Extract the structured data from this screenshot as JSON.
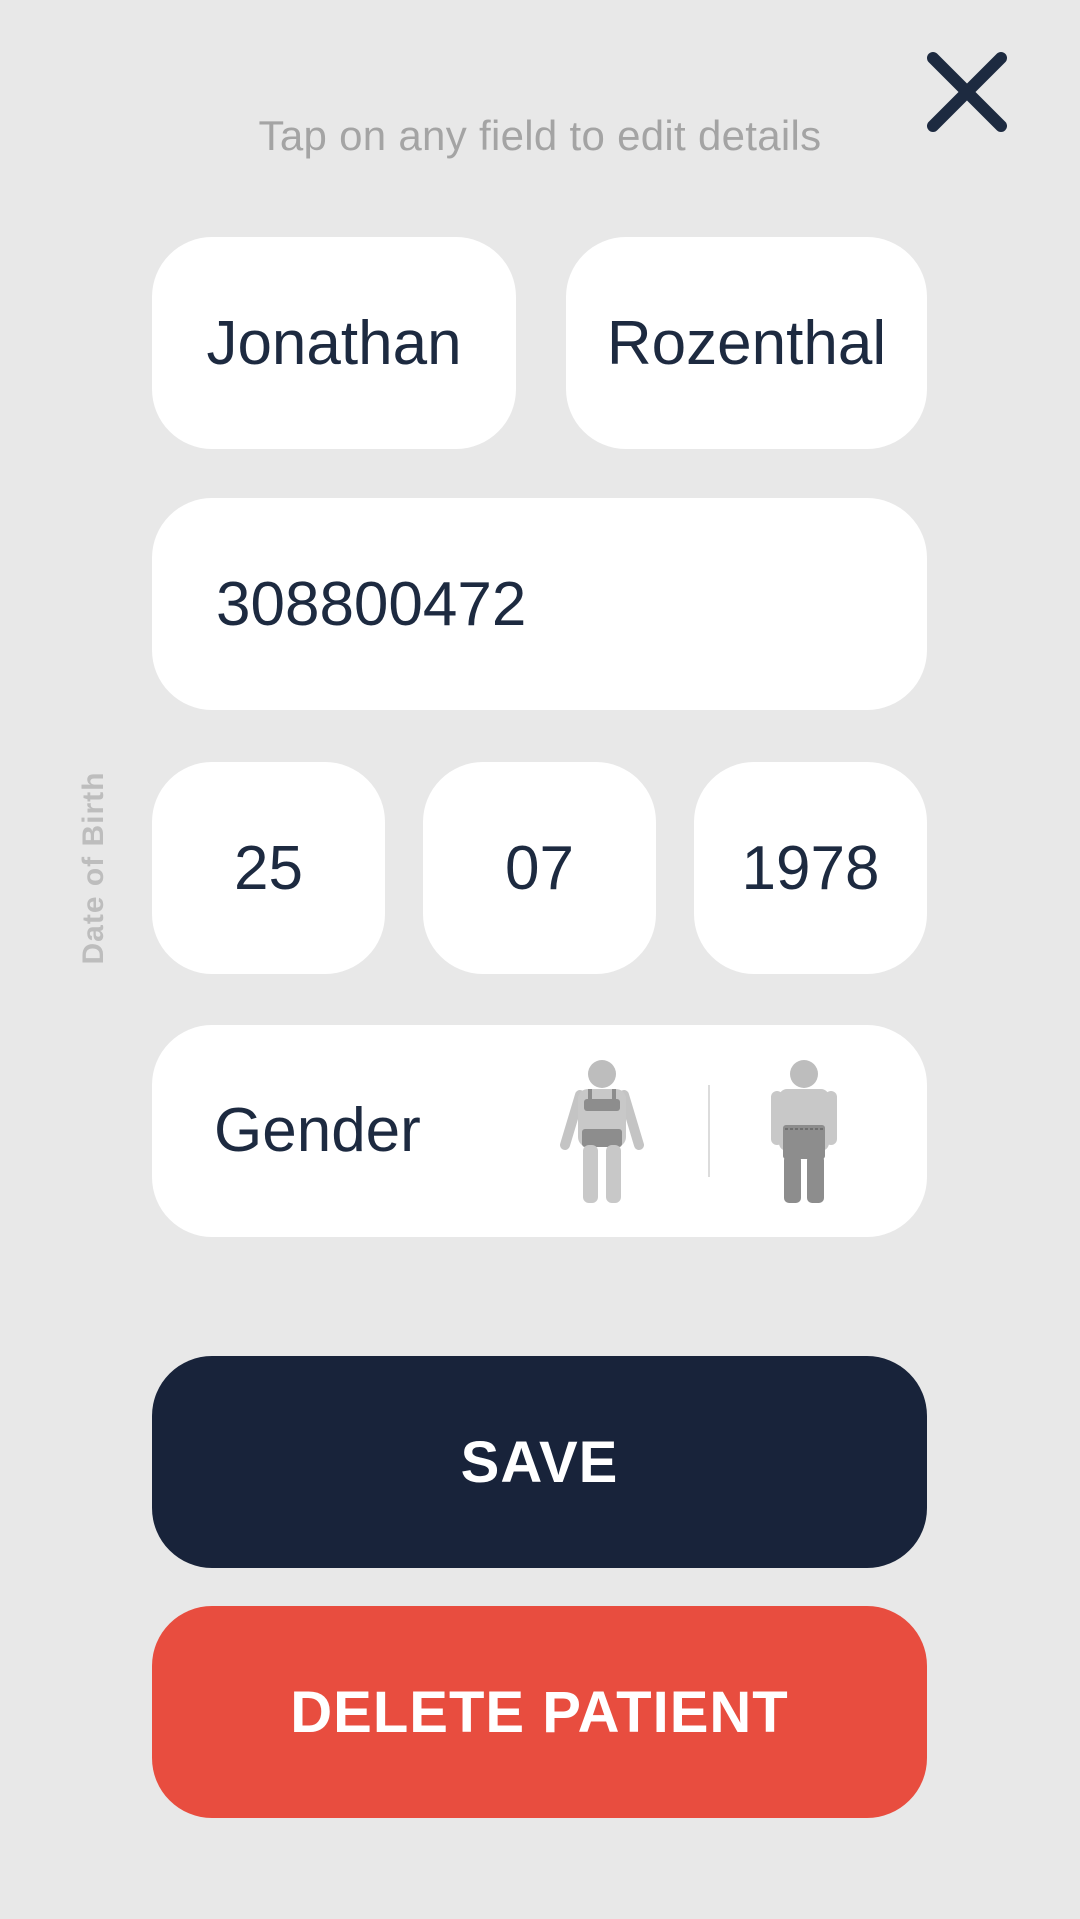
{
  "hint": "Tap on any field to edit details",
  "patient": {
    "first_name": "Jonathan",
    "last_name": "Rozenthal",
    "id_number": "308800472"
  },
  "dob": {
    "label": "Date of Birth",
    "day": "25",
    "month": "07",
    "year": "1978"
  },
  "gender": {
    "label": "Gender",
    "options": [
      "female-figure-icon",
      "male-figure-icon"
    ]
  },
  "buttons": {
    "save": "SAVE",
    "delete": "DELETE PATIENT"
  },
  "colors": {
    "background": "#e8e8e8",
    "text_dark": "#1d2a40",
    "save_bg": "#18233a",
    "delete_bg": "#e84d3f",
    "hint_text": "#a4a4a4"
  },
  "icons": {
    "close": "close-icon"
  }
}
